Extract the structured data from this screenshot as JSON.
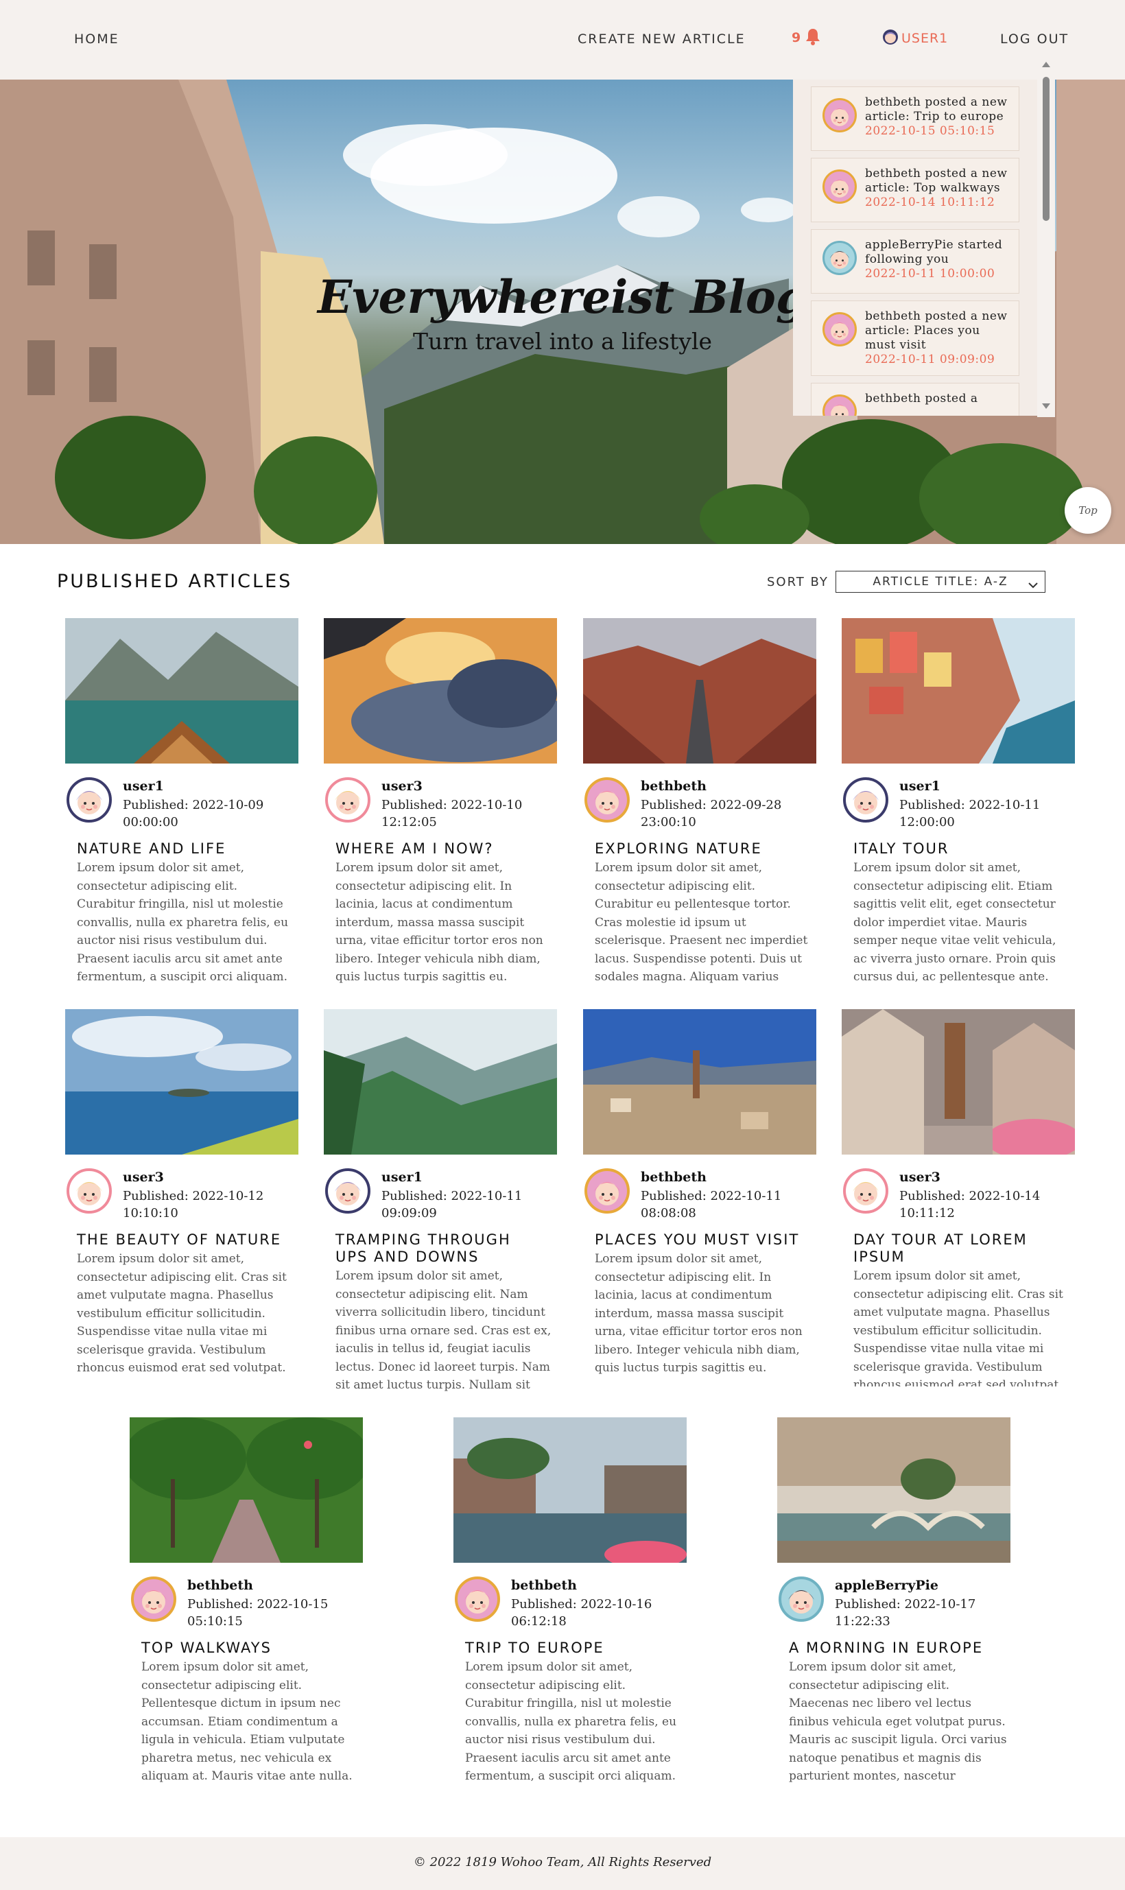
{
  "nav": {
    "home": "HOME",
    "create": "CREATE NEW ARTICLE",
    "notif_count": "9",
    "user": "USER1",
    "logout": "LOG OUT"
  },
  "hero": {
    "title": "Everywhereist Blog",
    "subtitle": "Turn travel into a lifestyle"
  },
  "notifications": [
    {
      "text": "bethbeth posted a new article: Trip to europe",
      "time": "2022-10-15 05:10:15",
      "avatar": "pink-girl-avatar"
    },
    {
      "text": "bethbeth posted a new article: Top walkways",
      "time": "2022-10-14 10:11:12",
      "avatar": "pink-girl-avatar"
    },
    {
      "text": "appleBerryPie started following you",
      "time": "2022-10-11 10:00:00",
      "avatar": "dark-hair-boy-avatar"
    },
    {
      "text": "bethbeth posted a new article: Places you must visit",
      "time": "2022-10-11 09:09:09",
      "avatar": "pink-girl-avatar"
    },
    {
      "text": "bethbeth posted a",
      "time": "",
      "avatar": "pink-girl-avatar"
    }
  ],
  "top_button": "Top",
  "articles_section": {
    "title": "PUBLISHED ARTICLES",
    "sort_label": "SORT BY",
    "sort_value": "ARTICLE TITLE: A-Z"
  },
  "articles": [
    {
      "author": "user1",
      "published": "Published: 2022-10-09 00:00:00",
      "title": "NATURE AND LIFE",
      "body": "Lorem ipsum dolor sit amet, consectetur adipiscing elit. Curabitur fringilla, nisl ut molestie convallis, nulla ex pharetra felis, eu auctor nisi risus vestibulum dui. Praesent iaculis arcu sit amet ante fermentum, a suscipit orci aliquam. Vivamus eu enim dignissim mauris",
      "image": "boat-lake-mountains-photo",
      "avatar": "purple-hair-girl-avatar"
    },
    {
      "author": "user3",
      "published": "Published: 2022-10-10 12:12:05",
      "title": "WHERE AM I NOW?",
      "body": "Lorem ipsum dolor sit amet, consectetur adipiscing elit. In lacinia, lacus at condimentum interdum, massa massa suscipit urna, vitae efficitur tortor eros non libero. Integer vehicula nibh diam, quis luctus turpis sagittis eu. Aliquam dictum, tellus non cosmmon",
      "image": "clouds-sunset-photo",
      "avatar": "blonde-girl-avatar"
    },
    {
      "author": "bethbeth",
      "published": "Published: 2022-09-28 23:00:10",
      "title": "EXPLORING NATURE",
      "body": "Lorem ipsum dolor sit amet, consectetur adipiscing elit. Curabitur eu pellentesque tortor. Cras molestie id ipsum ut scelerisque. Praesent nec imperdiet lacus. Suspendisse potenti. Duis ut sodales magna. Aliquam varius metus mi, ut lacinia tortor convallis sit",
      "image": "desert-road-photo",
      "avatar": "pink-girl-avatar"
    },
    {
      "author": "user1",
      "published": "Published: 2022-10-11 12:00:00",
      "title": "ITALY TOUR",
      "body": "Lorem ipsum dolor sit amet, consectetur adipiscing elit. Etiam sagittis velit elit, eget consectetur dolor imperdiet vitae. Mauris semper neque vitae velit vehicula, ac viverra justo ornare. Proin quis cursus dui, ac pellentesque ante. Nulla sodales malesuada diam, sed dapibus justo",
      "image": "cinque-terre-photo",
      "avatar": "purple-hair-girl-avatar"
    },
    {
      "author": "user3",
      "published": "Published: 2022-10-12 10:10:10",
      "title": "THE BEAUTY OF NATURE",
      "body": "Lorem ipsum dolor sit amet, consectetur adipiscing elit. Cras sit amet vulputate magna. Phasellus vestibulum efficitur sollicitudin. Suspendisse vitae nulla vitae mi scelerisque gravida. Vestibulum rhoncus euismod erat sed volutpat. Etiam vitae commodo tellus",
      "image": "coast-island-photo",
      "avatar": "blonde-girl-avatar"
    },
    {
      "author": "user1",
      "published": "Published: 2022-10-11 09:09:09",
      "title": "TRAMPING THROUGH UPS AND DOWNS",
      "body": "Lorem ipsum dolor sit amet, consectetur adipiscing elit. Nam viverra sollicitudin libero, tincidunt finibus urna ornare sed. Cras est ex, iaculis in tellus id, feugiat iaculis lectus. Donec id laoreet turpis. Nam sit amet luctus turpis. Nullam sit amet cursus tellus. Vivamus ac neque",
      "image": "green-valley-photo",
      "avatar": "purple-hair-girl-avatar"
    },
    {
      "author": "bethbeth",
      "published": "Published: 2022-10-11 08:08:08",
      "title": "PLACES YOU MUST VISIT",
      "body": "Lorem ipsum dolor sit amet, consectetur adipiscing elit. In lacinia, lacus at condimentum interdum, massa massa suscipit urna, vitae efficitur tortor eros non libero. Integer vehicula nibh diam, quis luctus turpis sagittis eu. Aliquam dictum, tellus non cosmmon",
      "image": "town-valley-photo",
      "avatar": "pink-girl-avatar"
    },
    {
      "author": "user3",
      "published": "Published: 2022-10-14 10:11:12",
      "title": "DAY TOUR AT LOREM IPSUM",
      "body": "Lorem ipsum dolor sit amet, consectetur adipiscing elit. Cras sit amet vulputate magna. Phasellus vestibulum efficitur sollicitudin. Suspendisse vitae nulla vitae mi scelerisque gravida. Vestibulum rhoncus euismod erat sed volutpat. Etiam vitae commodo tellus",
      "image": "old-town-street-photo",
      "avatar": "blonde-girl-avatar"
    },
    {
      "author": "bethbeth",
      "published": "Published: 2022-10-15 05:10:15",
      "title": "TOP WALKWAYS",
      "body": "Lorem ipsum dolor sit amet, consectetur adipiscing elit. Pellentesque dictum in ipsum nec accumsan. Etiam condimentum a ligula in vehicula. Etiam vulputate pharetra metus, nec vehicula ex aliquam at. Mauris vitae ante nulla. Sed at lacinia sem. Pellentesque",
      "image": "tree-walkway-photo",
      "avatar": "pink-girl-avatar"
    },
    {
      "author": "bethbeth",
      "published": "Published: 2022-10-16 06:12:18",
      "title": "TRIP TO EUROPE",
      "body": "Lorem ipsum dolor sit amet, consectetur adipiscing elit. Curabitur fringilla, nisl ut molestie convallis, nulla ex pharetra felis, eu auctor nisi risus vestibulum dui. Praesent iaculis arcu sit amet ante fermentum, a suscipit orci aliquam. Vivamus eu enim dignissim mauris",
      "image": "canal-city-photo",
      "avatar": "pink-girl-avatar"
    },
    {
      "author": "appleBerryPie",
      "published": "Published: 2022-10-17 11:22:33",
      "title": "A MORNING IN EUROPE",
      "body": "Lorem ipsum dolor sit amet, consectetur adipiscing elit. Maecenas nec libero vel lectus finibus vehicula eget volutpat purus. Mauris ac suscipit ligula. Orci varius natoque penatibus et magnis dis parturient montes, nascetur ridiculus mus. Maecenas suscipit sit",
      "image": "paris-bridge-photo",
      "avatar": "dark-hair-boy-avatar"
    }
  ],
  "footer": "© 2022 1819 Wohoo Team, All Rights Reserved"
}
